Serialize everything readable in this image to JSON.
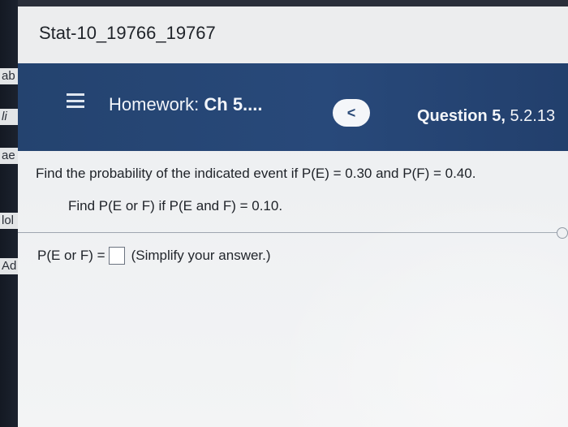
{
  "background": {
    "fragments": [
      "ab",
      "li",
      "ae",
      "lol",
      "Ad"
    ]
  },
  "header": {
    "course_title": "Stat-10_19766_19767"
  },
  "nav": {
    "homework_prefix": "Homework:",
    "homework_title": "Ch 5....",
    "back_symbol": "<",
    "question_prefix": "Question 5,",
    "question_number": "5.2.13"
  },
  "problem": {
    "line1": "Find the probability of the indicated event if P(E) = 0.30 and P(F) = 0.40.",
    "line2": "Find P(E or F) if P(E and F) = 0.10.",
    "answer_label": "P(E or F) =",
    "answer_value": "",
    "hint": "(Simplify your answer.)"
  },
  "colors": {
    "nav_bg": "#28497a",
    "screen_bg": "#eef0f2",
    "text": "#1e2228"
  }
}
